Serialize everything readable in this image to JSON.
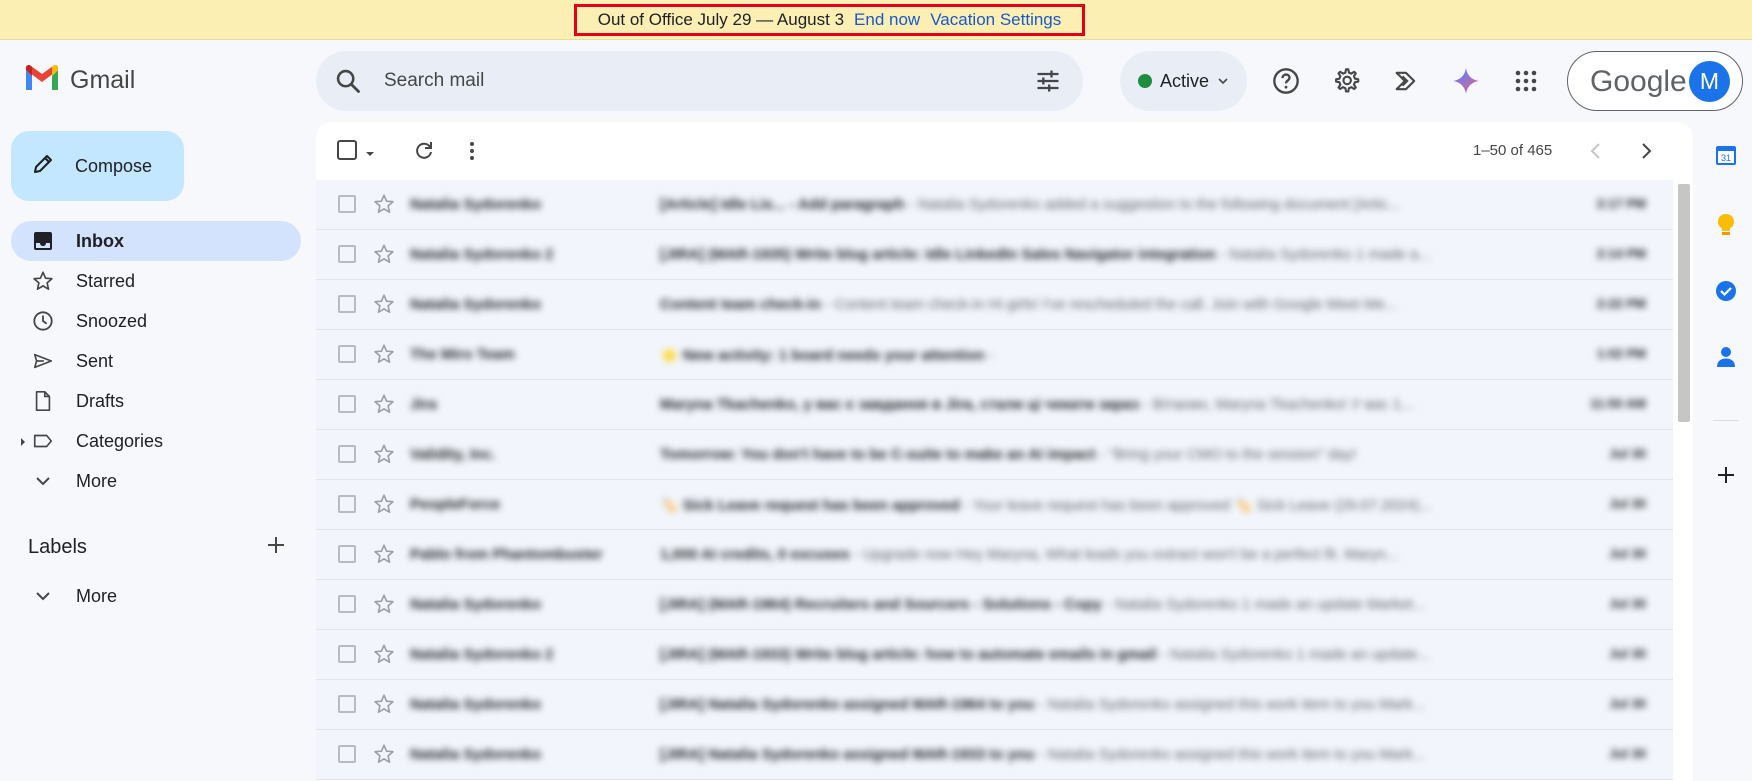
{
  "banner": {
    "text": "Out of Office July 29 — August 3",
    "end_now": "End now",
    "vacation_settings": "Vacation Settings"
  },
  "app": {
    "name": "Gmail"
  },
  "search": {
    "placeholder": "Search mail"
  },
  "status": {
    "label": "Active"
  },
  "account": {
    "brand": "Google",
    "avatar_letter": "M"
  },
  "compose": {
    "label": "Compose"
  },
  "nav": {
    "items": [
      {
        "label": "Inbox",
        "icon": "inbox-icon"
      },
      {
        "label": "Starred",
        "icon": "star-icon"
      },
      {
        "label": "Snoozed",
        "icon": "clock-icon"
      },
      {
        "label": "Sent",
        "icon": "send-icon"
      },
      {
        "label": "Drafts",
        "icon": "draft-icon"
      },
      {
        "label": "Categories",
        "icon": "label-icon"
      },
      {
        "label": "More",
        "icon": "chevron-down-icon"
      }
    ]
  },
  "labels": {
    "title": "Labels",
    "more": "More"
  },
  "pager": {
    "range": "1–50 of 465"
  },
  "emails": [
    {
      "sender": "Natalia Sydorenko",
      "subject": "[Article] Idle Lis... - Add paragraph",
      "snippet": " - Natalia Sydorenko added a suggestion to the following document [Artic...",
      "date": "2:17 PM"
    },
    {
      "sender": "Natalia Sydorenko 2",
      "subject": "[JIRA] (MAR-1935) Write blog article: Idle LinkedIn Sales Navigator integration",
      "snippet": " - Natalia Sydorenko 1 made a...",
      "date": "2:14 PM"
    },
    {
      "sender": "Natalia Sydorenko",
      "subject": "Content team check-in",
      "snippet": " - Content team check-in Hi girls! I've rescheduled the call. Join with Google Meet Me...",
      "date": "2:22 PM"
    },
    {
      "sender": "The Miro Team",
      "subject": "⭐ New activity: 1 board needs your attention",
      "snippet": " -",
      "date": "1:02 PM"
    },
    {
      "sender": "Jira",
      "subject": "Maryna Tkachenko, у вас є завдання в Jira, стали ці чекати зараз",
      "snippet": " - Вітаємо, Maryna Tkachenko! У вас 1...",
      "date": "11:50 AM"
    },
    {
      "sender": "Validity, Inc.",
      "subject": "Tomorrow: You don't have to be C-suite to make an AI impact",
      "snippet": " - \"Bring your CMO to the session\" day!",
      "date": "Jul 30"
    },
    {
      "sender": "PeopleForce",
      "subject": "🏷️ Sick Leave request has been approved",
      "snippet": " - Your leave request has been approved 🏷️ Sick Leave (29.07.2024)...",
      "date": "Jul 30"
    },
    {
      "sender": "Pablo from Phantombuster",
      "subject": "1,000 AI credits, 0 excuses",
      "snippet": " - Upgrade now Hey Maryna, What leads you extract won't be a perfect fit. Maryn...",
      "date": "Jul 30"
    },
    {
      "sender": "Natalia Sydorenko",
      "subject": "[JIRA] (MAR-1964) Recruiters and Sourcers - Solutions - Copy",
      "snippet": " - Natalia Sydorenko 1 made an update Market...",
      "date": "Jul 30"
    },
    {
      "sender": "Natalia Sydorenko 2",
      "subject": "[JIRA] (MAR-1933) Write blog article: how to automate emails in gmail",
      "snippet": " - Natalia Sydorenko 1 made an update...",
      "date": "Jul 30"
    },
    {
      "sender": "Natalia Sydorenko",
      "subject": "[JIRA] Natalia Sydorenko assigned MAR-1964 to you",
      "snippet": " - Natalia Sydorenko assigned this work item to you Mark...",
      "date": "Jul 30"
    },
    {
      "sender": "Natalia Sydorenko",
      "subject": "[JIRA] Natalia Sydorenko assigned MAR-1933 to you",
      "snippet": " - Natalia Sydorenko assigned this work item to you Mark...",
      "date": "Jul 30"
    }
  ],
  "colors": {
    "banner_bg": "#fcefb4",
    "highlight": "#e3001b",
    "link": "#1a58c8",
    "compose_bg": "#c2e7ff",
    "active_nav_bg": "#d3e3fd",
    "active_status": "#1e8e3e"
  }
}
